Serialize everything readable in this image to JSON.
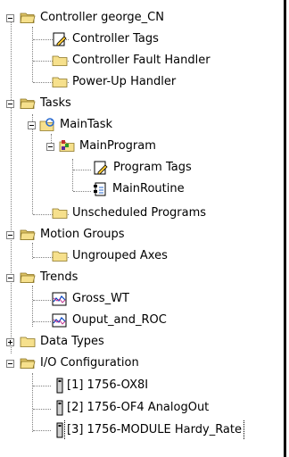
{
  "tree": {
    "nodes": [
      {
        "label": "Controller george_CN",
        "icon": "folder-open-icon",
        "expander": "minus"
      },
      {
        "label": "Controller Tags",
        "icon": "tag-pencil-icon"
      },
      {
        "label": "Controller Fault Handler",
        "icon": "folder-icon"
      },
      {
        "label": "Power-Up Handler",
        "icon": "folder-icon"
      },
      {
        "label": "Tasks",
        "icon": "folder-open-icon",
        "expander": "minus"
      },
      {
        "label": "MainTask",
        "icon": "task-cycle-icon",
        "expander": "minus"
      },
      {
        "label": "MainProgram",
        "icon": "program-folder-icon",
        "expander": "minus"
      },
      {
        "label": "Program Tags",
        "icon": "tag-pencil-icon"
      },
      {
        "label": "MainRoutine",
        "icon": "routine-icon"
      },
      {
        "label": "Unscheduled Programs",
        "icon": "folder-icon"
      },
      {
        "label": "Motion Groups",
        "icon": "folder-open-icon",
        "expander": "minus"
      },
      {
        "label": "Ungrouped Axes",
        "icon": "folder-icon"
      },
      {
        "label": "Trends",
        "icon": "folder-open-icon",
        "expander": "minus"
      },
      {
        "label": "Gross_WT",
        "icon": "trend-chart-icon"
      },
      {
        "label": "Ouput_and_ROC",
        "icon": "trend-chart-icon"
      },
      {
        "label": "Data Types",
        "icon": "folder-icon",
        "expander": "plus"
      },
      {
        "label": "I/O Configuration",
        "icon": "folder-open-icon",
        "expander": "minus"
      },
      {
        "label": "[1] 1756-OX8I",
        "icon": "io-module-icon"
      },
      {
        "label": "[2] 1756-OF4 AnalogOut",
        "icon": "io-module-icon"
      },
      {
        "label": "[3] 1756-MODULE Hardy_Rate",
        "icon": "io-module-icon",
        "selected": true
      }
    ]
  }
}
